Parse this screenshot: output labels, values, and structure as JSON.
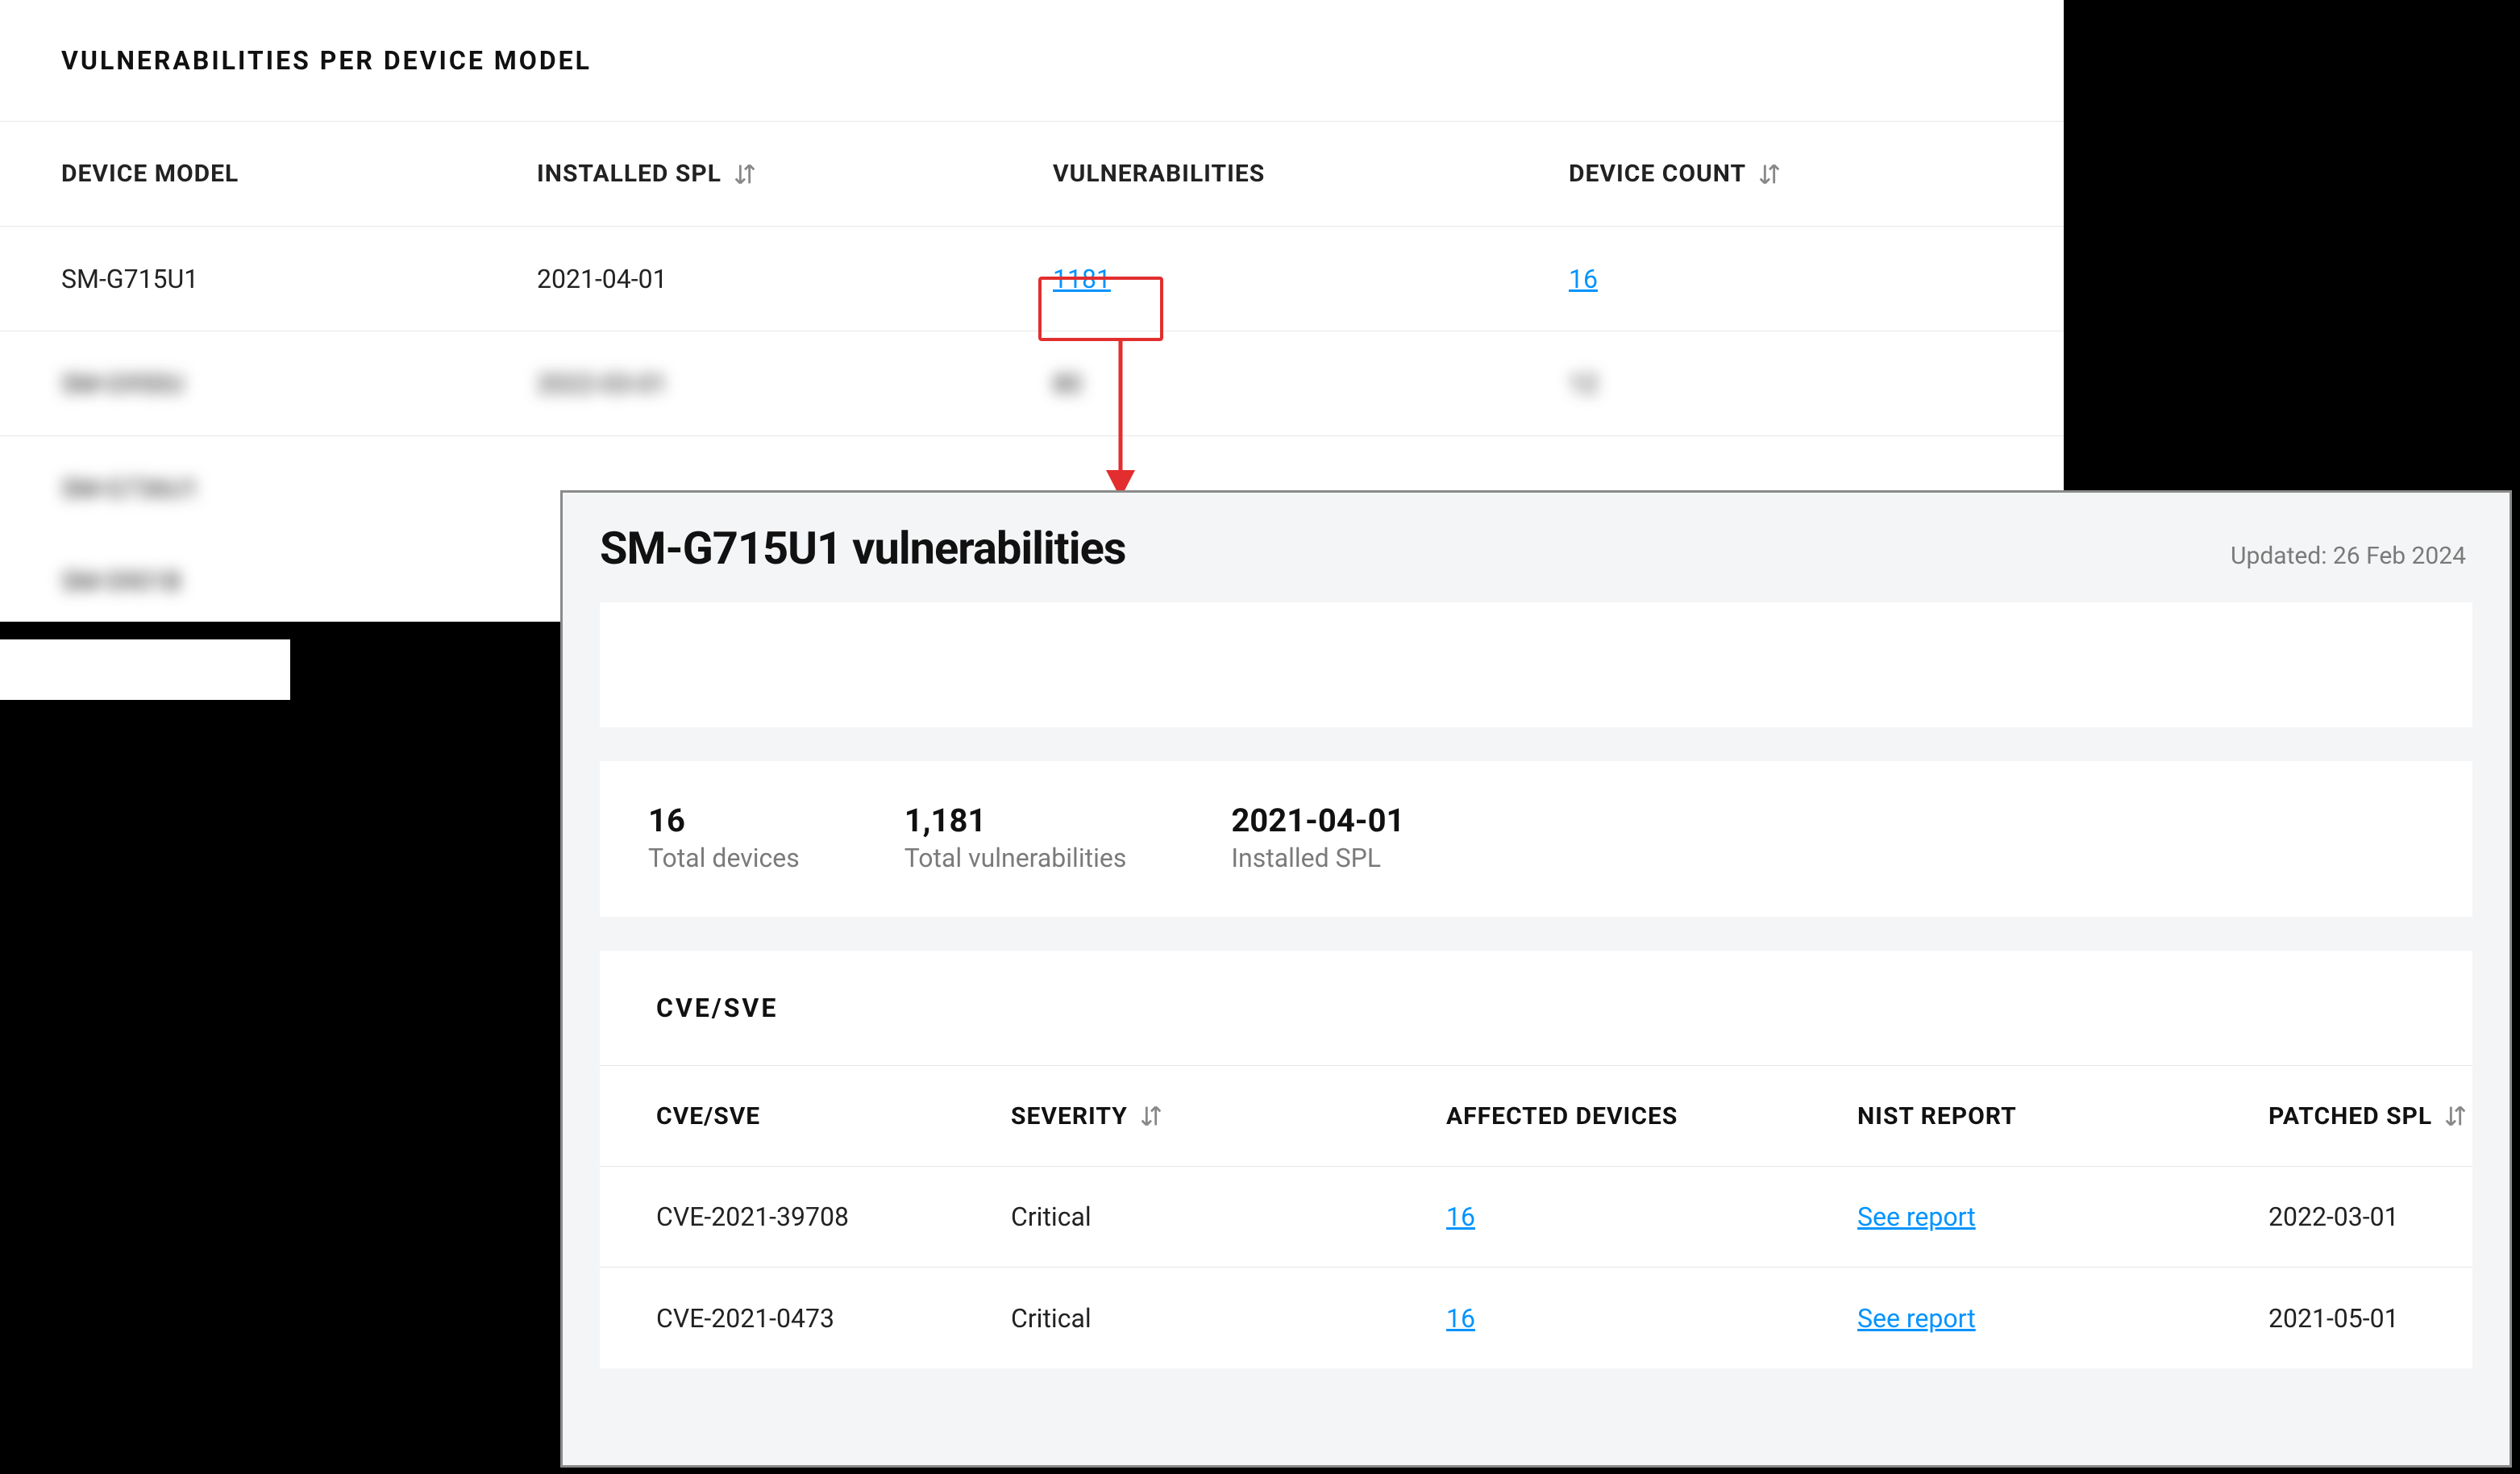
{
  "models_panel": {
    "title": "VULNERABILITIES PER DEVICE MODEL",
    "headers": {
      "device_model": "DEVICE MODEL",
      "installed_spl": "INSTALLED SPL",
      "vulnerabilities": "VULNERABILITIES",
      "device_count": "DEVICE COUNT"
    },
    "rows": [
      {
        "model": "SM-G715U1",
        "spl": "2021-04-01",
        "vulns": "1181",
        "count": "16"
      }
    ]
  },
  "detail_panel": {
    "title": "SM-G715U1 vulnerabilities",
    "updated": "Updated: 26 Feb 2024",
    "stats": {
      "devices_num": "16",
      "devices_lbl": "Total devices",
      "vulns_num": "1,181",
      "vulns_lbl": "Total vulnerabilities",
      "spl_num": "2021-04-01",
      "spl_lbl": "Installed SPL"
    },
    "cve_title": "CVE/SVE",
    "cve_headers": {
      "cve": "CVE/SVE",
      "severity": "SEVERITY",
      "affected": "AFFECTED DEVICES",
      "nist": "NIST REPORT",
      "patched": "PATCHED SPL"
    },
    "cve_rows": [
      {
        "cve": "CVE-2021-39708",
        "severity": "Critical",
        "affected": "16",
        "nist": "See report",
        "patched": "2022-03-01"
      },
      {
        "cve": "CVE-2021-0473",
        "severity": "Critical",
        "affected": "16",
        "nist": "See report",
        "patched": "2021-05-01"
      }
    ]
  }
}
